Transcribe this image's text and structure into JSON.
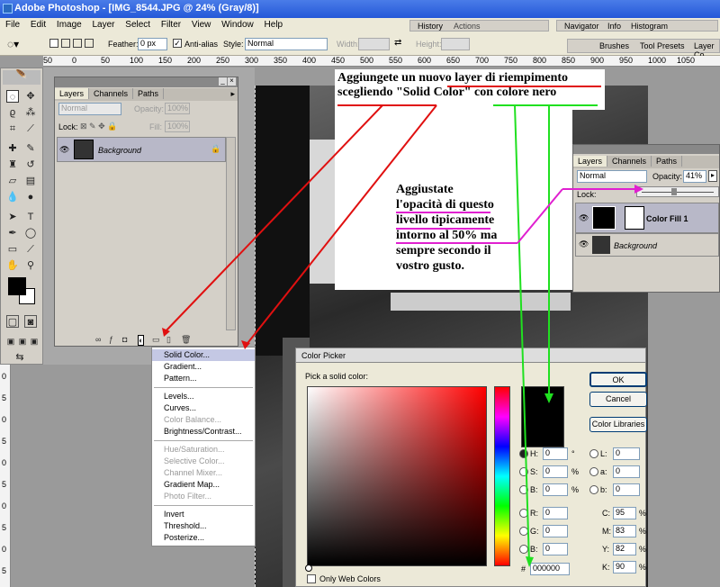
{
  "window_title": "Adobe Photoshop - [IMG_8544.JPG @ 24% (Gray/8)]",
  "menu": [
    "File",
    "Edit",
    "Image",
    "Layer",
    "Select",
    "Filter",
    "View",
    "Window",
    "Help"
  ],
  "options_bar": {
    "feather_label": "Feather:",
    "feather_value": "0 px",
    "antialias_label": "Anti-alias",
    "style_label": "Style:",
    "style_value": "Normal",
    "width_label": "Width:",
    "height_label": "Height:"
  },
  "palette_well": {
    "history_tab": "History",
    "actions_tab": "Actions",
    "navigator_tab": "Navigator",
    "info_tab": "Info",
    "histogram_tab": "Histogram",
    "brushes_tab": "Brushes",
    "tool_presets_tab": "Tool Presets",
    "layer_comps_tab": "Layer Co"
  },
  "ruler_ticks": [
    "50",
    "0",
    "50",
    "100",
    "150",
    "200",
    "250",
    "300",
    "350",
    "400",
    "450",
    "500",
    "550",
    "600",
    "650",
    "700",
    "750",
    "800",
    "850",
    "900",
    "950",
    "1000",
    "1050"
  ],
  "ruler_left": [
    "0",
    "5",
    "0",
    "5",
    "0",
    "5",
    "0",
    "5",
    "0",
    "5"
  ],
  "layers_panel": {
    "tabs": [
      "Layers",
      "Channels",
      "Paths"
    ],
    "blend": "Normal",
    "opacity_label": "Opacity:",
    "opacity_value": "100%",
    "lock_label": "Lock:",
    "fill_label": "Fill:",
    "fill_value": "100%",
    "layer_name": "Background"
  },
  "fill_menu": {
    "group1": [
      "Solid Color...",
      "Gradient...",
      "Pattern..."
    ],
    "group2": [
      "Levels...",
      "Curves...",
      "Color Balance...",
      "Brightness/Contrast..."
    ],
    "group3": [
      "Hue/Saturation...",
      "Selective Color...",
      "Channel Mixer...",
      "Gradient Map...",
      "Photo Filter..."
    ],
    "group4": [
      "Invert",
      "Threshold...",
      "Posterize..."
    ],
    "disabled": [
      "Color Balance...",
      "Hue/Saturation...",
      "Selective Color...",
      "Channel Mixer...",
      "Photo Filter..."
    ]
  },
  "annotations": {
    "top_line1": "Aggiungete un nuovo layer di riempimento",
    "top_line2": "scegliendo \"Solid Color\" con colore nero",
    "mid": [
      "Aggiustate",
      "l'opacità di questo",
      "livello tipicamente",
      "intorno al 50% ma",
      "sempre secondo il",
      "vostro gusto."
    ]
  },
  "layers_panel2": {
    "tabs": [
      "Layers",
      "Channels",
      "Paths"
    ],
    "blend": "Normal",
    "opacity_label": "Opacity:",
    "opacity_value": "41%",
    "lock_label": "Lock:",
    "layer1": "Color Fill 1",
    "layer2": "Background"
  },
  "color_picker": {
    "title": "Color Picker",
    "pick_label": "Pick a solid color:",
    "ok": "OK",
    "cancel": "Cancel",
    "libraries": "Color Libraries",
    "H": {
      "label": "H:",
      "value": "0",
      "unit": "°"
    },
    "S": {
      "label": "S:",
      "value": "0",
      "unit": "%"
    },
    "B": {
      "label": "B:",
      "value": "0",
      "unit": "%"
    },
    "R": {
      "label": "R:",
      "value": "0"
    },
    "G": {
      "label": "G:",
      "value": "0"
    },
    "Bb": {
      "label": "B:",
      "value": "0"
    },
    "L": {
      "label": "L:",
      "value": "0"
    },
    "a": {
      "label": "a:",
      "value": "0"
    },
    "b": {
      "label": "b:",
      "value": "0"
    },
    "C": {
      "label": "C:",
      "value": "95",
      "unit": "%"
    },
    "M": {
      "label": "M:",
      "value": "83",
      "unit": "%"
    },
    "Y": {
      "label": "Y:",
      "value": "82",
      "unit": "%"
    },
    "K": {
      "label": "K:",
      "value": "90",
      "unit": "%"
    },
    "hex_label": "#",
    "hex": "000000",
    "web_only": "Only Web Colors"
  },
  "colors": {
    "title_blue": "#2458d8",
    "annot_red": "#e01010",
    "annot_green": "#20e020",
    "annot_magenta": "#e020d0"
  }
}
